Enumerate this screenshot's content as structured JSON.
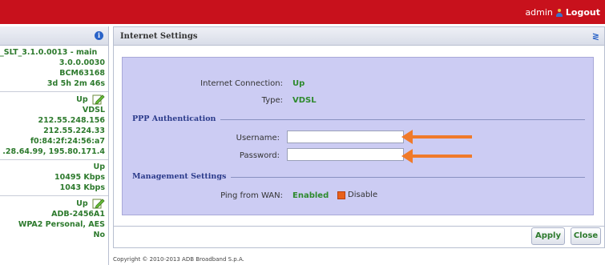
{
  "header": {
    "username": "admin",
    "logout_label": "Logout",
    "bg_color": "#c8111c"
  },
  "sidebar": {
    "device_lines": [
      "_SLT_3.1.0.0013 - main",
      "3.0.0.0030",
      "BCM63168",
      "3d 5h 2m 46s"
    ],
    "wan_status": "Up",
    "wan_lines": [
      "VDSL",
      "212.55.248.156",
      "212.55.224.33",
      "f0:84:2f:24:56:a7",
      ".28.64.99, 195.80.171.4"
    ],
    "dsl_status": "Up",
    "dsl_lines": [
      "10495 Kbps",
      "1043 Kbps"
    ],
    "wifi_status": "Up",
    "wifi_lines": [
      "ADB-2456A1",
      "WPA2 Personal, AES",
      "No"
    ]
  },
  "panel": {
    "title": "Internet Settings",
    "internet_connection_label": "Internet Connection:",
    "internet_connection_value": "Up",
    "type_label": "Type:",
    "type_value": "VDSL",
    "ppp_section": "PPP Authentication",
    "username_label": "Username:",
    "username_value": "",
    "password_label": "Password:",
    "password_value": "",
    "mgmt_section": "Management Settings",
    "ping_label": "Ping from WAN:",
    "ping_value": "Enabled",
    "disable_label": "Disable",
    "arrow_color": "#f07a2a"
  },
  "footer": {
    "apply_label": "Apply",
    "close_label": "Close",
    "copyright": "Copyright © 2010-2013 ADB Broadband S.p.A."
  }
}
